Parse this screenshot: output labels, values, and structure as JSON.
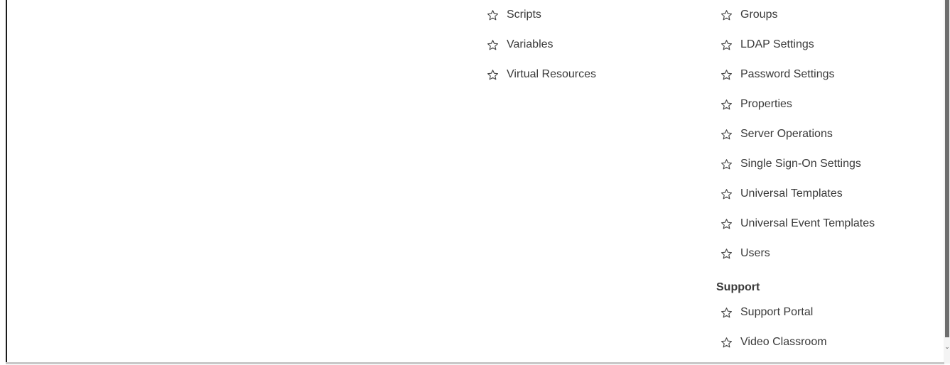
{
  "columns": {
    "left": {
      "items": [
        {
          "label": "Scripts",
          "icon": "star-outline-icon"
        },
        {
          "label": "Variables",
          "icon": "star-outline-icon"
        },
        {
          "label": "Virtual Resources",
          "icon": "star-outline-icon"
        }
      ]
    },
    "right": {
      "items": [
        {
          "label": "Groups",
          "icon": "star-outline-icon"
        },
        {
          "label": "LDAP Settings",
          "icon": "star-outline-icon"
        },
        {
          "label": "Password Settings",
          "icon": "star-outline-icon"
        },
        {
          "label": "Properties",
          "icon": "star-outline-icon"
        },
        {
          "label": "Server Operations",
          "icon": "star-outline-icon"
        },
        {
          "label": "Single Sign-On Settings",
          "icon": "star-outline-icon"
        },
        {
          "label": "Universal Templates",
          "icon": "star-outline-icon"
        },
        {
          "label": "Universal Event Templates",
          "icon": "star-outline-icon"
        },
        {
          "label": "Users",
          "icon": "star-outline-icon"
        }
      ]
    }
  },
  "support": {
    "heading": "Support",
    "items": [
      {
        "label": "Support Portal",
        "icon": "star-outline-icon"
      },
      {
        "label": "Video Classroom",
        "icon": "star-outline-icon"
      }
    ]
  },
  "scrollbar": {
    "arrow_glyph": "⌄"
  },
  "colors": {
    "text": "#3a3a3a",
    "border": "#1a1a1a",
    "scrollbar_thumb": "#6e6e6e"
  }
}
